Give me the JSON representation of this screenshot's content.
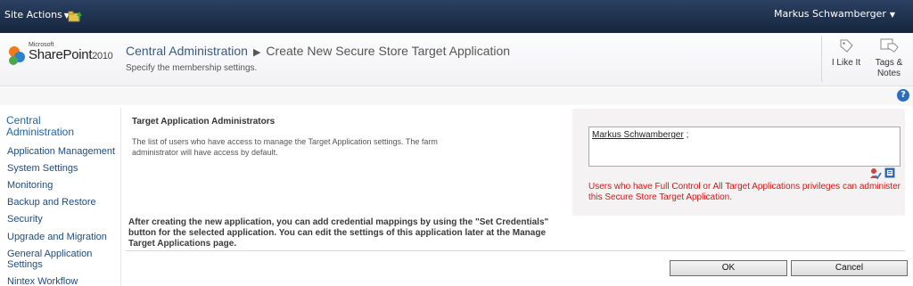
{
  "topbar": {
    "site_actions": "Site Actions",
    "user_name": "Markus Schwamberger"
  },
  "logo": {
    "microsoft": "Microsoft",
    "product": "SharePoint",
    "version": "2010"
  },
  "header": {
    "breadcrumb_root": "Central Administration",
    "breadcrumb_current": "Create New Secure Store Target Application",
    "subtitle": "Specify the membership settings.",
    "i_like_it": "I Like It",
    "tags_notes": "Tags & Notes"
  },
  "leftnav": {
    "heading": "Central Administration",
    "items": [
      {
        "label": "Application Management"
      },
      {
        "label": "System Settings"
      },
      {
        "label": "Monitoring"
      },
      {
        "label": "Backup and Restore"
      },
      {
        "label": "Security"
      },
      {
        "label": "Upgrade and Migration"
      },
      {
        "label": "General Application Settings"
      },
      {
        "label": "Nintex Workflow"
      }
    ]
  },
  "section": {
    "title": "Target Application Administrators",
    "description": "The list of users who have access to manage the Target Application settings. The farm administrator will have access by default.",
    "people_value": "Markus Schwamberger",
    "people_separator": " ;",
    "warning": "Users who have Full Control or All Target Applications privileges can administer this Secure Store Target Application."
  },
  "note": "After creating the new application, you can add credential mappings by using the \"Set Credentials\" button for the selected application. You can edit the settings of this application later at the Manage Target Applications page.",
  "buttons": {
    "ok": "OK",
    "cancel": "Cancel"
  },
  "colors": {
    "topbar": "#1c2f4a",
    "link": "#1f63a6",
    "warning": "#e01212"
  },
  "icons": {
    "help": "help-icon",
    "check_names": "check-names-icon",
    "browse": "address-book-icon"
  }
}
